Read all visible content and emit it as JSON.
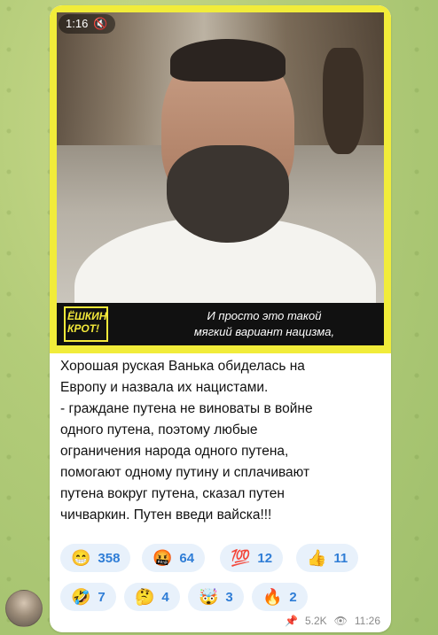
{
  "post": {
    "media": {
      "duration": "1:16",
      "subtitle_lines": [
        "И просто это такой",
        "мягкий вариант нацизма,"
      ],
      "logo_text": [
        "ЁШКИН",
        "КРОТ!"
      ]
    },
    "text_lines": [
      "Хорошая руская Ванька обиделась на",
      "Европу и назвала их нацистами.",
      "-  граждане путена не виноваты в войне",
      "одного путена, поэтому любые",
      "ограничения народа одного путена,",
      "помогают одному путину и сплачивают",
      "путена вокруг путена, сказал путен",
      "чичваркин. Путен введи вайска!!!"
    ],
    "reactions": [
      {
        "emoji": "😁",
        "count": "358",
        "name": "grinning-icon"
      },
      {
        "emoji": "🤬",
        "count": "64",
        "name": "cursing-face-icon"
      },
      {
        "emoji": "💯",
        "count": "12",
        "name": "hundred-icon"
      },
      {
        "emoji": "👍",
        "count": "11",
        "name": "thumbs-up-icon"
      },
      {
        "emoji": "🤣",
        "count": "7",
        "name": "rofl-icon"
      },
      {
        "emoji": "🤔",
        "count": "4",
        "name": "thinking-icon"
      },
      {
        "emoji": "🤯",
        "count": "3",
        "name": "exploding-head-icon"
      },
      {
        "emoji": "🔥",
        "count": "2",
        "name": "fire-icon"
      }
    ],
    "meta": {
      "views": "5.2K",
      "time": "11:26"
    }
  },
  "colors": {
    "accent": "#2f7dd6",
    "reaction_bg": "#e8f1fb",
    "frame": "#f1ec3a"
  }
}
